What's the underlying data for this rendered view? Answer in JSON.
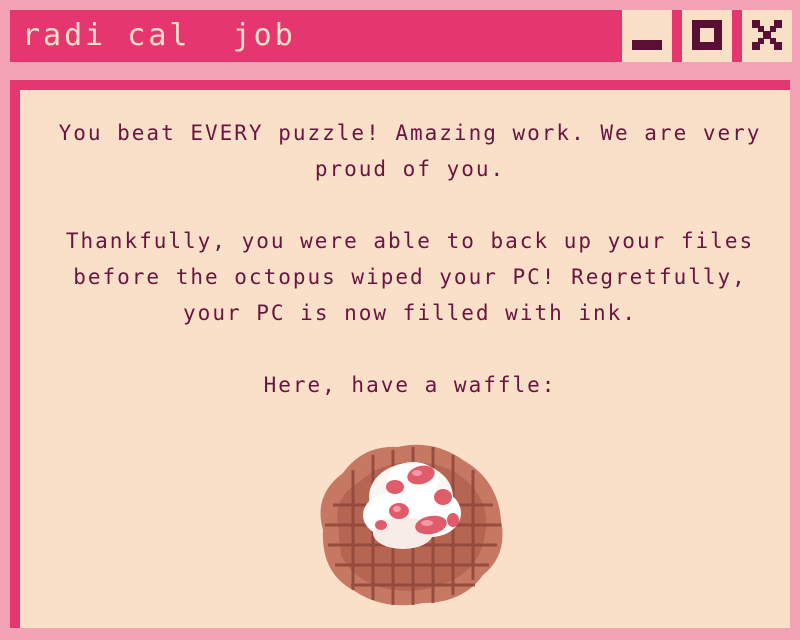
{
  "window": {
    "title": "radi cal  job",
    "buttons": {
      "minimize_icon": "minimize-icon",
      "maximize_icon": "maximize-icon",
      "close_icon": "close-icon"
    }
  },
  "message": {
    "paragraph_1": "You beat EVERY puzzle! Amazing work. We are very proud of you.",
    "paragraph_2": "Thankfully, you were able to back up your files before the octopus wiped your PC! Regretfully, your PC is now filled with ink.",
    "paragraph_3": "Here, have a waffle:"
  },
  "colors": {
    "background_pink": "#f4a3b6",
    "accent_magenta": "#e6366f",
    "panel_cream": "#fae0c8",
    "text_maroon": "#6a1540",
    "icon_dark": "#5a0f35"
  }
}
